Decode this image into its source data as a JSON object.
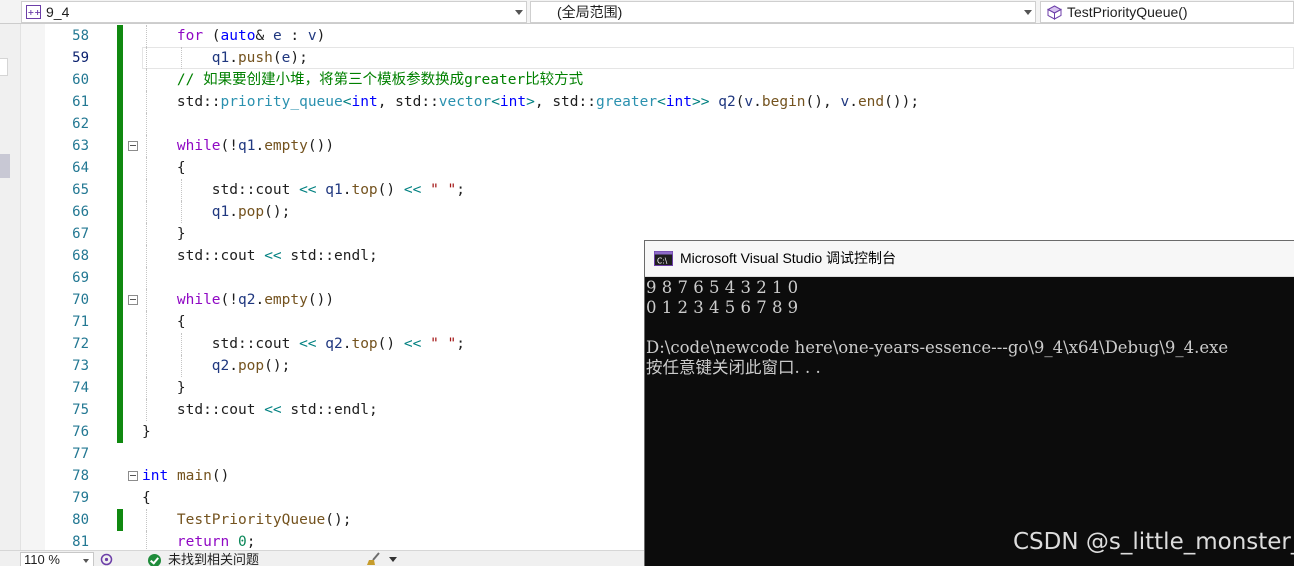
{
  "navbar": {
    "project": "9_4",
    "scope": "(全局范围)",
    "function": "TestPriorityQueue()"
  },
  "editor": {
    "current_line": 59,
    "lines": [
      {
        "n": "58",
        "changed": true,
        "tokens": [
          [
            "kw",
            "for"
          ],
          [
            "",
            " ("
          ],
          [
            "ty",
            "auto"
          ],
          [
            "",
            "& "
          ],
          [
            "vr",
            "e"
          ],
          [
            "",
            " : "
          ],
          [
            "vr",
            "v"
          ],
          [
            "",
            ")"
          ]
        ]
      },
      {
        "n": "59",
        "changed": true,
        "tokens": [
          [
            "vr",
            "q1"
          ],
          [
            "",
            "."
          ],
          [
            "fn",
            "push"
          ],
          [
            "",
            "("
          ],
          [
            "vr",
            "e"
          ],
          [
            "",
            ");"
          ]
        ]
      },
      {
        "n": "60",
        "changed": true,
        "tokens": [
          [
            "cm",
            "// 如果要创建小堆，将第三个模板参数换成greater比较方式"
          ]
        ]
      },
      {
        "n": "61",
        "changed": true,
        "tokens": [
          [
            "",
            "std::"
          ],
          [
            "tp",
            "priority_queue"
          ],
          [
            "op",
            "<"
          ],
          [
            "ty",
            "int"
          ],
          [
            "",
            ", std::"
          ],
          [
            "tp",
            "vector"
          ],
          [
            "op",
            "<"
          ],
          [
            "ty",
            "int"
          ],
          [
            "op",
            ">"
          ],
          [
            "",
            ", std::"
          ],
          [
            "tp",
            "greater"
          ],
          [
            "op",
            "<"
          ],
          [
            "ty",
            "int"
          ],
          [
            "op",
            ">>"
          ],
          [
            "",
            " "
          ],
          [
            "vr",
            "q2"
          ],
          [
            "",
            "("
          ],
          [
            "vr",
            "v"
          ],
          [
            "",
            "."
          ],
          [
            "fn",
            "begin"
          ],
          [
            "",
            "(), "
          ],
          [
            "vr",
            "v"
          ],
          [
            "",
            "."
          ],
          [
            "fn",
            "end"
          ],
          [
            "",
            "());"
          ]
        ]
      },
      {
        "n": "62",
        "changed": true,
        "tokens": []
      },
      {
        "n": "63",
        "changed": true,
        "fold": true,
        "tokens": [
          [
            "kw",
            "while"
          ],
          [
            "",
            "(!"
          ],
          [
            "vr",
            "q1"
          ],
          [
            "",
            "."
          ],
          [
            "fn",
            "empty"
          ],
          [
            "",
            "())"
          ]
        ]
      },
      {
        "n": "64",
        "changed": true,
        "tokens": [
          [
            "",
            "{"
          ]
        ]
      },
      {
        "n": "65",
        "changed": true,
        "tokens": [
          [
            "",
            "std::cout "
          ],
          [
            "op",
            "<<"
          ],
          [
            "",
            " "
          ],
          [
            "vr",
            "q1"
          ],
          [
            "",
            "."
          ],
          [
            "fn",
            "top"
          ],
          [
            "",
            "() "
          ],
          [
            "op",
            "<<"
          ],
          [
            "",
            " "
          ],
          [
            "st",
            "\" \""
          ],
          [
            "",
            ";"
          ]
        ]
      },
      {
        "n": "66",
        "changed": true,
        "tokens": [
          [
            "vr",
            "q1"
          ],
          [
            "",
            "."
          ],
          [
            "fn",
            "pop"
          ],
          [
            "",
            "();"
          ]
        ]
      },
      {
        "n": "67",
        "changed": true,
        "tokens": [
          [
            "",
            "}"
          ]
        ]
      },
      {
        "n": "68",
        "changed": true,
        "tokens": [
          [
            "",
            "std::cout "
          ],
          [
            "op",
            "<<"
          ],
          [
            "",
            " std::endl;"
          ]
        ]
      },
      {
        "n": "69",
        "changed": true,
        "tokens": []
      },
      {
        "n": "70",
        "changed": true,
        "fold": true,
        "tokens": [
          [
            "kw",
            "while"
          ],
          [
            "",
            "(!"
          ],
          [
            "vr",
            "q2"
          ],
          [
            "",
            "."
          ],
          [
            "fn",
            "empty"
          ],
          [
            "",
            "())"
          ]
        ]
      },
      {
        "n": "71",
        "changed": true,
        "tokens": [
          [
            "",
            "{"
          ]
        ]
      },
      {
        "n": "72",
        "changed": true,
        "tokens": [
          [
            "",
            "std::cout "
          ],
          [
            "op",
            "<<"
          ],
          [
            "",
            " "
          ],
          [
            "vr",
            "q2"
          ],
          [
            "",
            "."
          ],
          [
            "fn",
            "top"
          ],
          [
            "",
            "() "
          ],
          [
            "op",
            "<<"
          ],
          [
            "",
            " "
          ],
          [
            "st",
            "\" \""
          ],
          [
            "",
            ";"
          ]
        ]
      },
      {
        "n": "73",
        "changed": true,
        "tokens": [
          [
            "vr",
            "q2"
          ],
          [
            "",
            "."
          ],
          [
            "fn",
            "pop"
          ],
          [
            "",
            "();"
          ]
        ]
      },
      {
        "n": "74",
        "changed": true,
        "tokens": [
          [
            "",
            "}"
          ]
        ]
      },
      {
        "n": "75",
        "changed": true,
        "tokens": [
          [
            "",
            "std::cout "
          ],
          [
            "op",
            "<<"
          ],
          [
            "",
            " std::endl;"
          ]
        ]
      },
      {
        "n": "76",
        "changed": true,
        "tokens": [
          [
            "",
            "}"
          ]
        ]
      },
      {
        "n": "77",
        "changed": false,
        "tokens": []
      },
      {
        "n": "78",
        "changed": false,
        "fold": true,
        "tokens": [
          [
            "ty",
            "int"
          ],
          [
            "",
            " "
          ],
          [
            "fn",
            "main"
          ],
          [
            "",
            "()"
          ]
        ]
      },
      {
        "n": "79",
        "changed": false,
        "tokens": [
          [
            "",
            "{"
          ]
        ]
      },
      {
        "n": "80",
        "changed": true,
        "tokens": [
          [
            "fn",
            "TestPriorityQueue"
          ],
          [
            "",
            "();"
          ]
        ]
      },
      {
        "n": "81",
        "changed": false,
        "tokens": [
          [
            "kw",
            "return"
          ],
          [
            "",
            " "
          ],
          [
            "nm",
            "0"
          ],
          [
            "",
            ";"
          ]
        ]
      }
    ]
  },
  "statusbar": {
    "zoom": "110 %",
    "issues": "未找到相关问题"
  },
  "console": {
    "title": "Microsoft Visual Studio 调试控制台",
    "lines": [
      "9 8 7 6 5 4 3 2 1 0",
      "0 1 2 3 4 5 6 7 8 9",
      "",
      "D:\\code\\newcode here\\one-years-essence---go\\9_4\\x64\\Debug\\9_4.exe",
      "按任意键关闭此窗口. . ."
    ]
  },
  "watermark": "CSDN @s_little_monster_",
  "colors": {
    "change_bar": "#108910",
    "keyword": "#8f08c4",
    "type": "#0000ff",
    "class": "#2b91af",
    "variable": "#1f377f",
    "function": "#74531f",
    "comment": "#008000",
    "string": "#a31515",
    "console_bg": "#0c0c0c",
    "console_text": "#cccccc"
  }
}
